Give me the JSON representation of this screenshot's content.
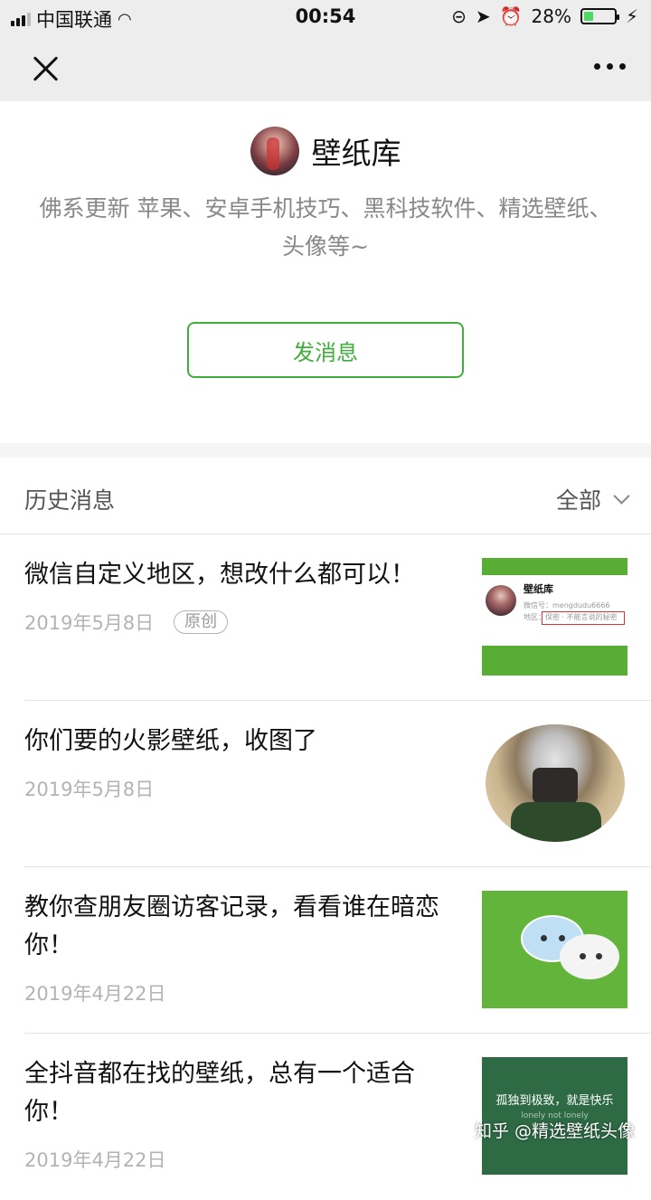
{
  "status_bar": {
    "carrier": "中国联通",
    "time": "00:54",
    "battery": "28%",
    "battery_level": 0.28
  },
  "account": {
    "name": "壁纸库",
    "description": "佛系更新 苹果、安卓手机技巧、黑科技软件、精选壁纸、头像等~",
    "send_button": "发消息"
  },
  "history": {
    "title": "历史消息",
    "filter_label": "全部"
  },
  "articles": [
    {
      "title": "微信自定义地区，想改什么都可以！",
      "date": "2019年5月8日",
      "tag": "原创"
    },
    {
      "title": "你们要的火影壁纸，收图了",
      "date": "2019年5月8日"
    },
    {
      "title": "教你查朋友圈访客记录，看看谁在暗恋你！",
      "date": "2019年4月22日"
    },
    {
      "title": "全抖音都在找的壁纸，总有一个适合你！",
      "date": "2019年4月22日"
    }
  ],
  "thumb1": {
    "name": "壁纸库",
    "wechat_id": "微信号：mengdudu6666",
    "region": "地区：保密 · 不能言说的秘密"
  },
  "thumb4": {
    "slogan": "孤独到极致，就是快乐",
    "sub": "lonely not lonely"
  },
  "watermark": "知乎 @精选壁纸头像",
  "colors": {
    "accent_green": "#3eaf3b",
    "nav_bg": "#ededed"
  },
  "icons": {
    "close": "close-icon",
    "more": "more-icon",
    "filter": "chevron-down-icon"
  }
}
